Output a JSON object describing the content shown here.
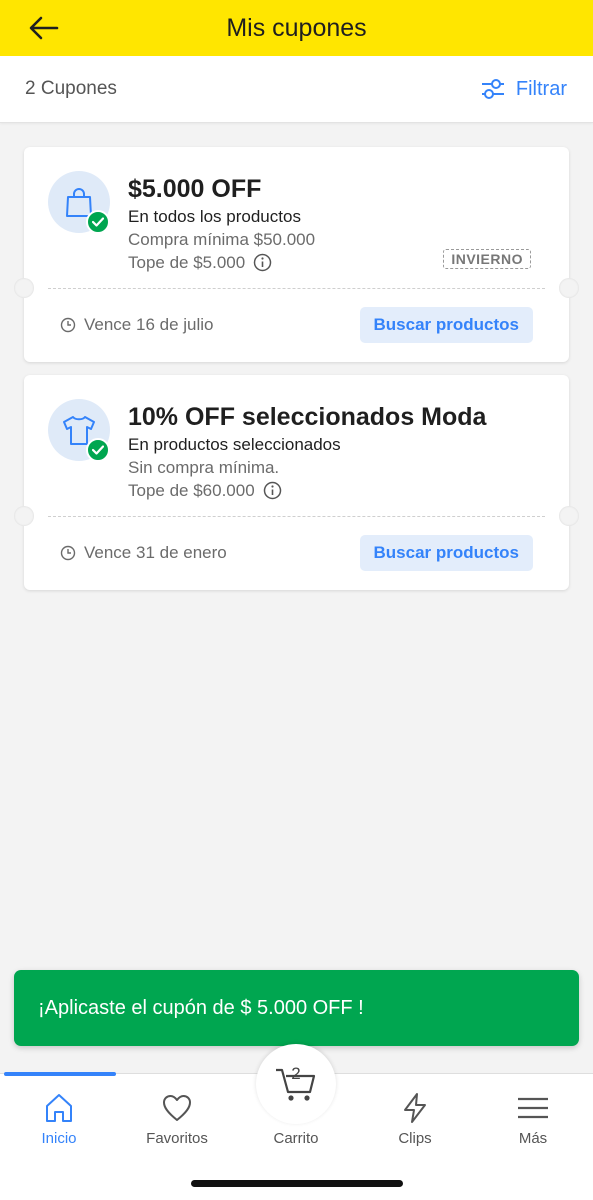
{
  "header": {
    "title": "Mis cupones"
  },
  "subheader": {
    "count_label": "2 Cupones",
    "filter_label": "Filtrar"
  },
  "coupons": [
    {
      "title": "$5.000 OFF",
      "description": "En todos los productos",
      "min_purchase": "Compra mínima $50.000",
      "cap": "Tope de $5.000",
      "code": "INVIERNO",
      "expiry": "Vence 16 de julio",
      "action_label": "Buscar productos",
      "icon": "shopping-bag-icon"
    },
    {
      "title": "10% OFF seleccionados Moda",
      "description": "En productos seleccionados",
      "min_purchase": "Sin compra mínima.",
      "cap": "Tope de $60.000",
      "code": "",
      "expiry": "Vence 31 de enero",
      "action_label": "Buscar productos",
      "icon": "tshirt-icon"
    }
  ],
  "toast": {
    "message": "¡Aplicaste el cupón de $ 5.000 OFF !"
  },
  "nav": {
    "items": [
      {
        "label": "Inicio",
        "icon": "home-icon",
        "active": true
      },
      {
        "label": "Favoritos",
        "icon": "heart-icon",
        "active": false
      },
      {
        "label": "Carrito",
        "icon": "cart-icon",
        "active": false
      },
      {
        "label": "Clips",
        "icon": "lightning-icon",
        "active": false
      },
      {
        "label": "Más",
        "icon": "menu-icon",
        "active": false
      }
    ],
    "cart_count": "2"
  },
  "colors": {
    "brand_yellow": "#ffe600",
    "accent_blue": "#3483fa",
    "success_green": "#00a650"
  }
}
